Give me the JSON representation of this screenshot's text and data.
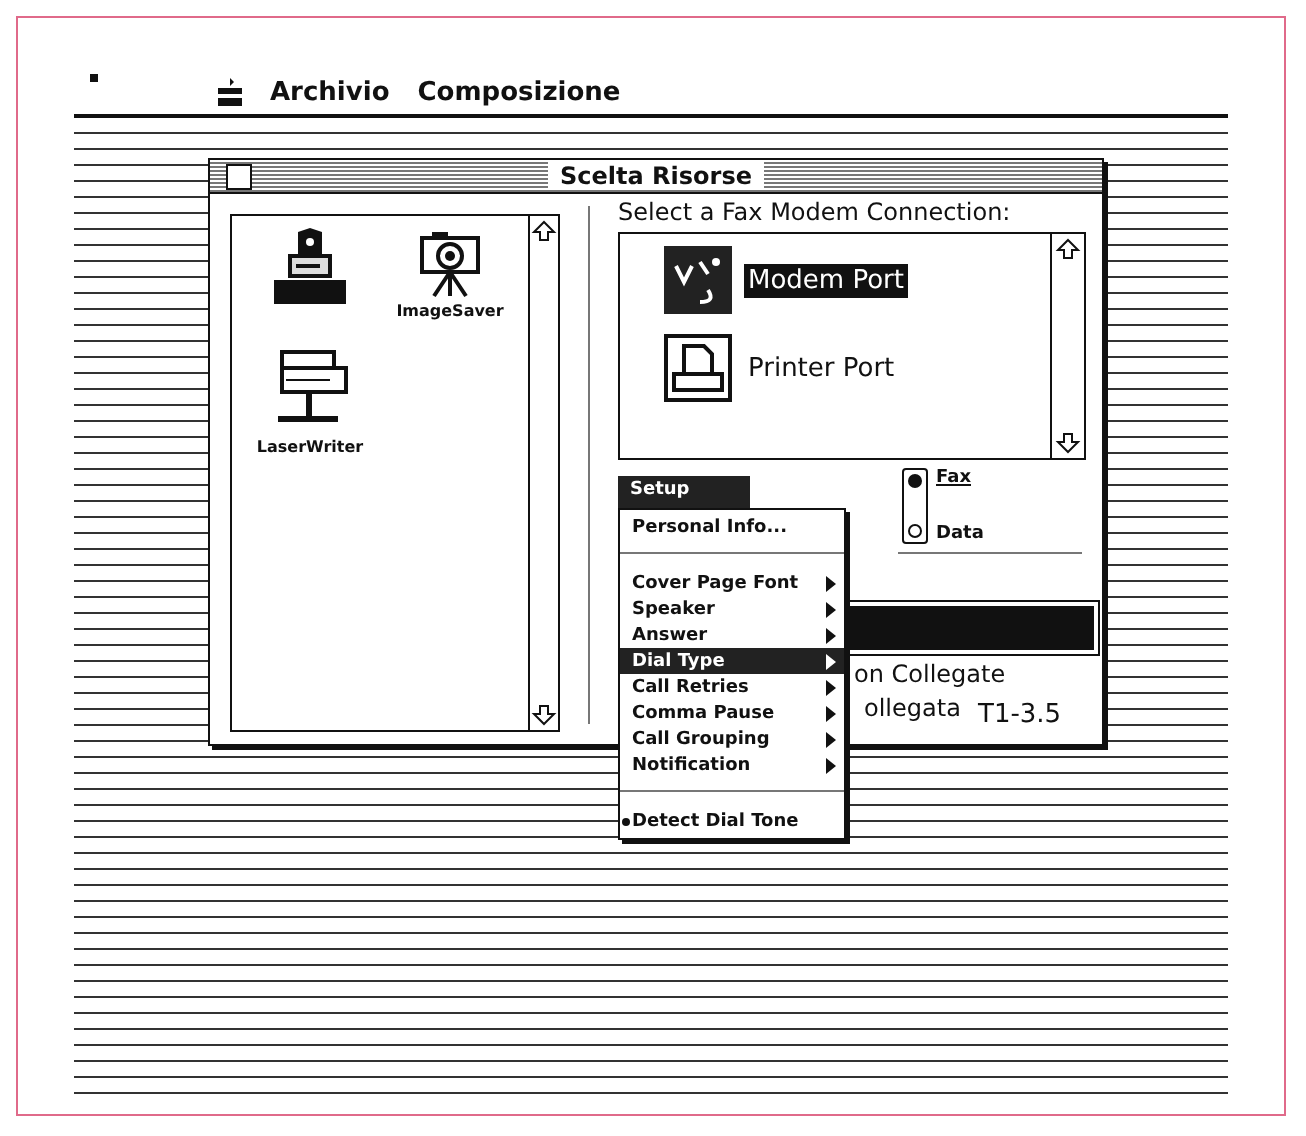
{
  "menu_bar": {
    "items": [
      "Archivio",
      "Composizione"
    ]
  },
  "window": {
    "title": "Scelta Risorse",
    "devices": [
      {
        "kind": "fax",
        "selected": true
      },
      {
        "kind": "camera",
        "label": "ImageSaver",
        "selected": false
      },
      {
        "kind": "laser",
        "label": "LaserWriter",
        "selected": false
      }
    ],
    "connection_prompt": "Select a Fax Modem Connection:",
    "ports": [
      {
        "kind": "modem",
        "label": "Modem Port",
        "selected": true
      },
      {
        "kind": "printer",
        "label": "Printer Port",
        "selected": false
      }
    ],
    "mode_switch": [
      {
        "label": "Fax",
        "selected": true
      },
      {
        "label": "Data",
        "selected": false
      }
    ],
    "status_lines": [
      "on Collegate",
      "ollegata"
    ]
  },
  "popup_menu": {
    "title": "Setup",
    "items": [
      {
        "kind": "item",
        "label": "Personal Info...",
        "selected": false
      },
      {
        "kind": "separator"
      },
      {
        "kind": "submenu",
        "label": "Cover Page Font",
        "selected": false
      },
      {
        "kind": "submenu",
        "label": "Speaker",
        "selected": false
      },
      {
        "kind": "submenu",
        "label": "Answer",
        "selected": false
      },
      {
        "kind": "submenu",
        "label": "Dial Type",
        "selected": true
      },
      {
        "kind": "submenu",
        "label": "Call Retries",
        "selected": false
      },
      {
        "kind": "submenu",
        "label": "Comma Pause",
        "selected": false
      },
      {
        "kind": "submenu",
        "label": "Call Grouping",
        "selected": false
      },
      {
        "kind": "submenu",
        "label": "Notification",
        "selected": false
      },
      {
        "kind": "separator"
      },
      {
        "kind": "check",
        "label": "Detect Dial Tone",
        "checked": true
      }
    ]
  },
  "figure_label": "T1-3.5"
}
